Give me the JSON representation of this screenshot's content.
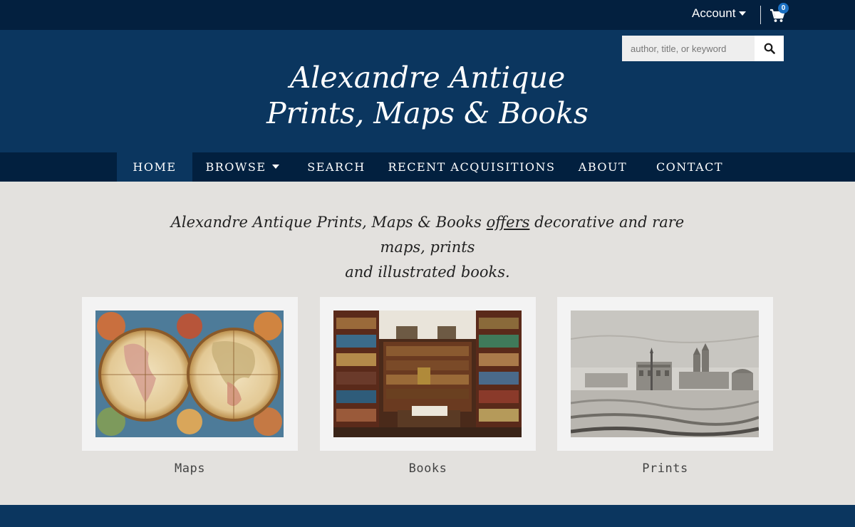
{
  "topbar": {
    "account_label": "Account",
    "cart_count": "0"
  },
  "header": {
    "search_placeholder": "author, title, or keyword",
    "logo_line1": "Alexandre Antique",
    "logo_line2": "Prints, Maps & Books"
  },
  "nav": {
    "items": [
      {
        "label": "HOME",
        "active": true
      },
      {
        "label": "BROWSE",
        "dropdown": true
      },
      {
        "label": "SEARCH"
      },
      {
        "label": "RECENT ACQUISITIONS"
      },
      {
        "label": "ABOUT"
      },
      {
        "label": "CONTACT"
      }
    ]
  },
  "main": {
    "tagline_part1": "Alexandre Antique Prints, Maps & Books ",
    "tagline_link": "offers",
    "tagline_part2": " decorative and rare maps, prints",
    "tagline_line2": "and illustrated books.",
    "categories": [
      {
        "label": "Maps",
        "image": "antique-world-map"
      },
      {
        "label": "Books",
        "image": "bookshop-interior"
      },
      {
        "label": "Prints",
        "image": "engraving-piazza"
      }
    ]
  },
  "colors": {
    "topbar": "#03203f",
    "header": "#0b365f",
    "nav": "#02203f",
    "background": "#e3e1de",
    "card": "#f3f3f3"
  }
}
